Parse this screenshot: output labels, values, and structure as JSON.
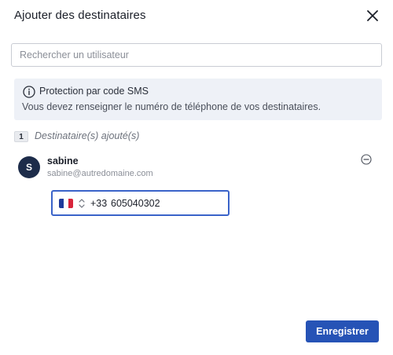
{
  "dialog": {
    "title": "Ajouter des destinataires",
    "close_icon": "close-icon"
  },
  "search": {
    "placeholder": "Rechercher un utilisateur",
    "value": ""
  },
  "info": {
    "icon": "info-icon",
    "title": "Protection par code SMS",
    "text": "Vous devez renseigner le numéro de téléphone de vos destinataires."
  },
  "recipients": {
    "count": "1",
    "label": "Destinataire(s) ajouté(s)",
    "items": [
      {
        "initial": "S",
        "name": "sabine",
        "email": "sabine@autredomaine.com",
        "phone": {
          "country_flag": "france-flag-icon",
          "dial_code": "+33",
          "number": "605040302"
        }
      }
    ]
  },
  "colors": {
    "primary": "#2653b6",
    "avatar_bg": "#1d2c4a",
    "info_bg": "#eef1f7",
    "focus_border": "#3a63c9"
  },
  "footer": {
    "save_label": "Enregistrer"
  }
}
